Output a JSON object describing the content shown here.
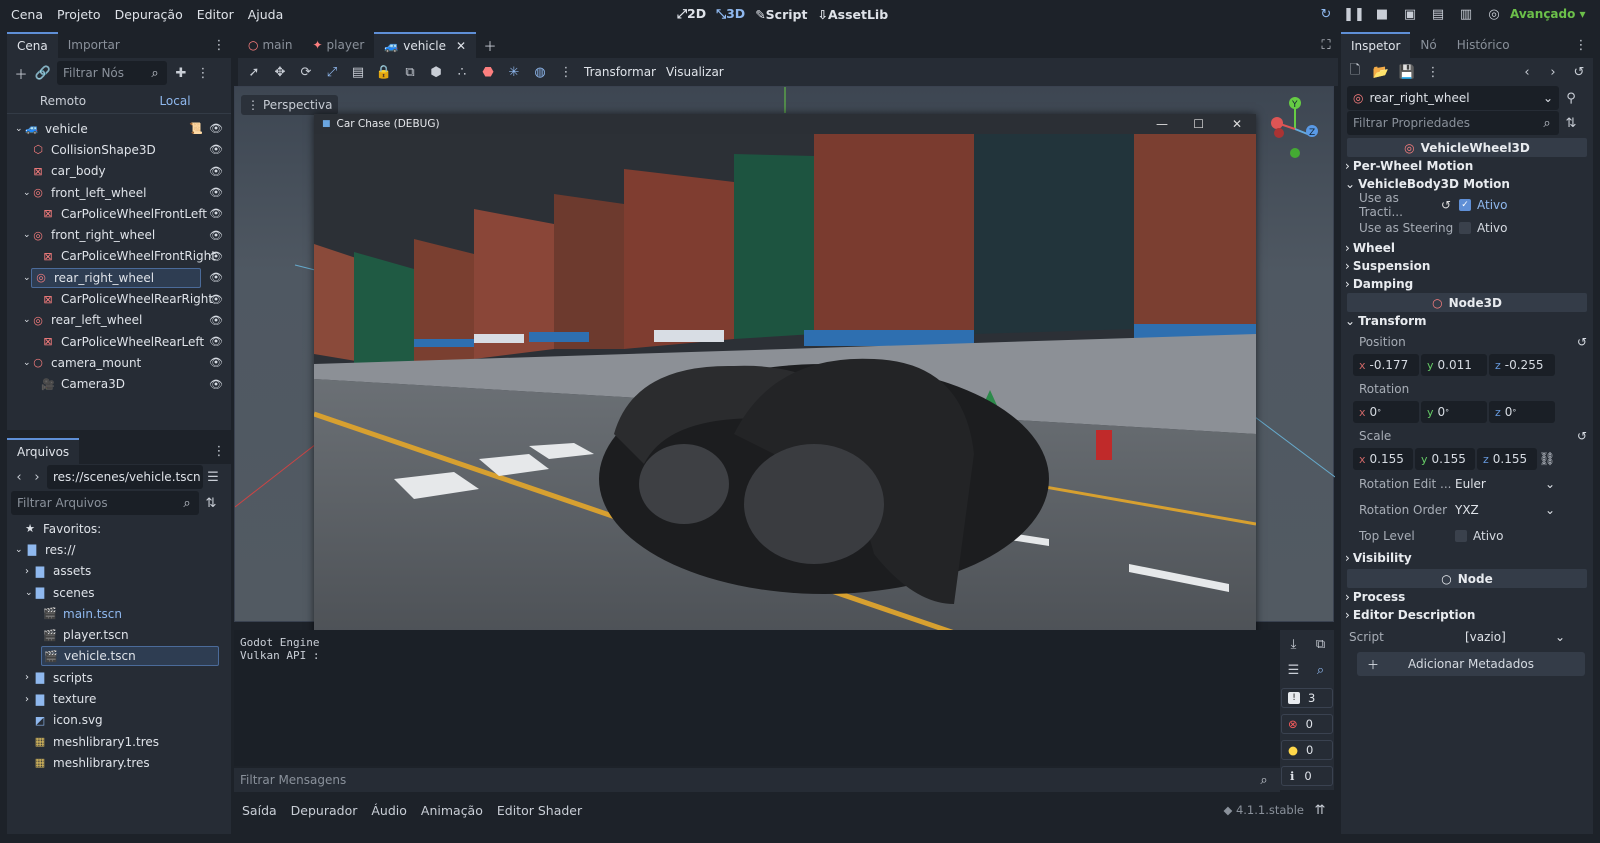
{
  "menu": [
    "Cena",
    "Projeto",
    "Depuração",
    "Editor",
    "Ajuda"
  ],
  "modes": [
    {
      "label": "2D",
      "icon": "2d-icon",
      "active": false
    },
    {
      "label": "3D",
      "icon": "3d-icon",
      "active": true
    },
    {
      "label": "Script",
      "icon": "script-icon",
      "active": false
    },
    {
      "label": "AssetLib",
      "icon": "assetlib-icon",
      "active": false
    }
  ],
  "renderer": "Avançado",
  "scene_dock": {
    "tabs": [
      "Cena",
      "Importar"
    ],
    "filter_placeholder": "Filtrar Nós",
    "remote": "Remoto",
    "local": "Local",
    "tree": [
      {
        "label": "vehicle",
        "icon": "vehicle-icon",
        "depth": 0,
        "expanded": true,
        "script": true
      },
      {
        "label": "CollisionShape3D",
        "icon": "collision-shape-icon",
        "depth": 1
      },
      {
        "label": "car_body",
        "icon": "mesh-instance-icon",
        "depth": 1
      },
      {
        "label": "front_left_wheel",
        "icon": "vehicle-wheel-icon",
        "depth": 1,
        "expanded": true
      },
      {
        "label": "CarPoliceWheelFrontLeft",
        "icon": "mesh-instance-icon",
        "depth": 2
      },
      {
        "label": "front_right_wheel",
        "icon": "vehicle-wheel-icon",
        "depth": 1,
        "expanded": true
      },
      {
        "label": "CarPoliceWheelFrontRight",
        "icon": "mesh-instance-icon",
        "depth": 2
      },
      {
        "label": "rear_right_wheel",
        "icon": "vehicle-wheel-icon",
        "depth": 1,
        "expanded": true,
        "selected": true
      },
      {
        "label": "CarPoliceWheelRearRight",
        "icon": "mesh-instance-icon",
        "depth": 2
      },
      {
        "label": "rear_left_wheel",
        "icon": "vehicle-wheel-icon",
        "depth": 1,
        "expanded": true
      },
      {
        "label": "CarPoliceWheelRearLeft",
        "icon": "mesh-instance-icon",
        "depth": 2
      },
      {
        "label": "camera_mount",
        "icon": "node3d-icon",
        "depth": 1,
        "expanded": true
      },
      {
        "label": "Camera3D",
        "icon": "camera-icon",
        "depth": 2
      }
    ]
  },
  "files_dock": {
    "tab": "Arquivos",
    "path": "res://scenes/vehicle.tscn",
    "filter_placeholder": "Filtrar Arquivos",
    "tree": [
      {
        "label": "Favoritos:",
        "icon": "star-icon",
        "depth": 0
      },
      {
        "label": "res://",
        "icon": "folder-icon",
        "depth": 0,
        "expanded": true
      },
      {
        "label": "assets",
        "icon": "folder-icon",
        "depth": 1,
        "collapsed": true
      },
      {
        "label": "scenes",
        "icon": "folder-icon",
        "depth": 1,
        "expanded": true
      },
      {
        "label": "main.tscn",
        "icon": "scene-file-icon",
        "depth": 2,
        "highlight": true
      },
      {
        "label": "player.tscn",
        "icon": "scene-file-icon",
        "depth": 2
      },
      {
        "label": "vehicle.tscn",
        "icon": "scene-file-icon",
        "depth": 2,
        "selected": true
      },
      {
        "label": "scripts",
        "icon": "folder-icon",
        "depth": 1,
        "collapsed": true
      },
      {
        "label": "texture",
        "icon": "folder-icon",
        "depth": 1,
        "collapsed": true
      },
      {
        "label": "icon.svg",
        "icon": "svg-file-icon",
        "depth": 1
      },
      {
        "label": "meshlibrary1.tres",
        "icon": "resource-file-icon",
        "depth": 1
      },
      {
        "label": "meshlibrary.tres",
        "icon": "resource-file-icon",
        "depth": 1
      }
    ]
  },
  "scene_tabs": [
    {
      "label": "main",
      "active": false
    },
    {
      "label": "player",
      "active": false
    },
    {
      "label": "vehicle",
      "active": true
    }
  ],
  "viewport_toolbar": {
    "transform": "Transformar",
    "view": "Visualizar",
    "perspective": "Perspectiva"
  },
  "game_window": {
    "title": "Car Chase (DEBUG)"
  },
  "output": {
    "lines": [
      "Godot Engine",
      "Vulkan API :"
    ],
    "filter_placeholder": "Filtrar Mensagens",
    "counts": {
      "messages": "3",
      "errors": "0",
      "warnings": "0",
      "info": "0"
    },
    "bottom_tabs": [
      "Saída",
      "Depurador",
      "Áudio",
      "Animação",
      "Editor Shader"
    ],
    "version": "4.1.1.stable"
  },
  "inspector": {
    "tabs": [
      "Inspetor",
      "Nó",
      "Histórico"
    ],
    "node_name": "rear_right_wheel",
    "filter_placeholder": "Filtrar Propriedades",
    "class1": "VehicleWheel3D",
    "sections1": [
      "Per-Wheel Motion",
      "VehicleBody3D Motion"
    ],
    "use_traction_label": "Use as Tracti...",
    "use_traction_value": "Ativo",
    "use_steering_label": "Use as Steering",
    "use_steering_value": "Ativo",
    "sections2": [
      "Wheel",
      "Suspension",
      "Damping"
    ],
    "class2": "Node3D",
    "transform": "Transform",
    "position_label": "Position",
    "position": {
      "x": "-0.177",
      "y": "0.011",
      "z": "-0.255"
    },
    "rotation_label": "Rotation",
    "rotation": {
      "x": "0",
      "y": "0",
      "z": "0"
    },
    "scale_label": "Scale",
    "scale": {
      "x": "0.155",
      "y": "0.155",
      "z": "0.155"
    },
    "rotation_edit_label": "Rotation Edit ...",
    "rotation_edit_value": "Euler",
    "rotation_order_label": "Rotation Order",
    "rotation_order_value": "YXZ",
    "top_level_label": "Top Level",
    "top_level_value": "Ativo",
    "visibility": "Visibility",
    "class3": "Node",
    "process": "Process",
    "editor_description": "Editor Description",
    "script_label": "Script",
    "script_value": "[vazio]",
    "add_metadata": "Adicionar Metadados"
  }
}
